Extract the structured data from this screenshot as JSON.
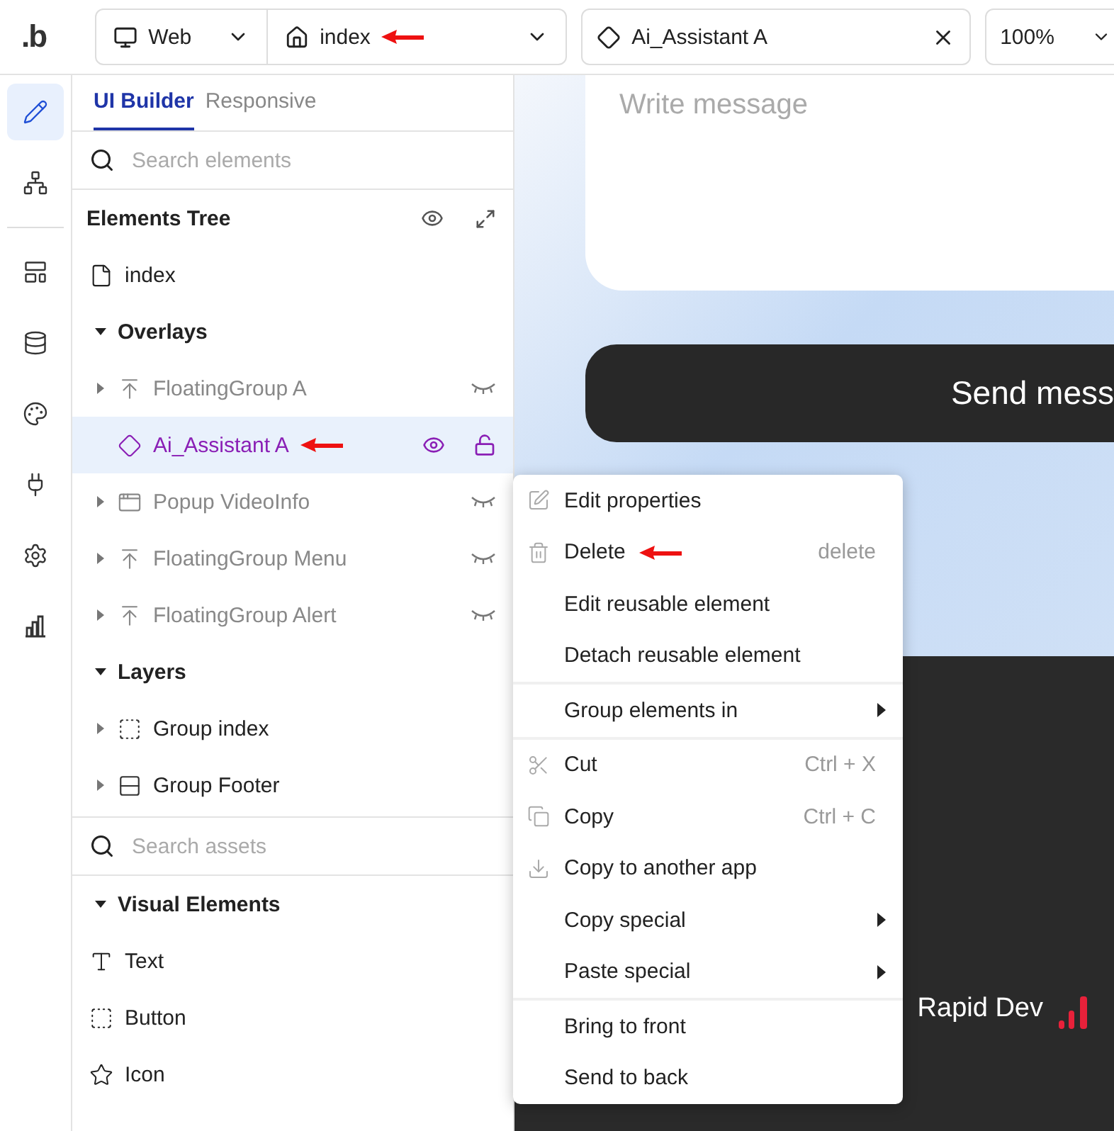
{
  "toolbar": {
    "logo": ".b",
    "platform": "Web",
    "page": {
      "label": "index",
      "annotated": true
    },
    "element": "Ai_Assistant A",
    "zoom": "100%"
  },
  "rail": [
    {
      "selected": true
    },
    {
      "selected": false
    },
    {
      "selected": false
    },
    {
      "selected": false
    },
    {
      "selected": false
    },
    {
      "selected": false
    },
    {
      "selected": false
    },
    {
      "selected": false
    }
  ],
  "panel_tabs": [
    {
      "label": "UI Builder",
      "selected": true
    },
    {
      "label": "Responsive",
      "selected": false
    }
  ],
  "search_elements": {
    "placeholder": "Search elements"
  },
  "tree_title": "Elements Tree",
  "page_item": "index",
  "sections": [
    {
      "label": "Overlays",
      "expanded": true,
      "items": [
        {
          "kind": "floating",
          "label": "FloatingGroup A",
          "has_children": true,
          "hidden": true,
          "selected": false,
          "annotated": false
        },
        {
          "kind": "reusable",
          "label": "Ai_Assistant A",
          "has_children": false,
          "hidden": false,
          "selected": true,
          "annotated": true
        },
        {
          "kind": "popup",
          "label": "Popup VideoInfo",
          "has_children": true,
          "hidden": true,
          "selected": false,
          "annotated": false
        },
        {
          "kind": "floating",
          "label": "FloatingGroup Menu",
          "has_children": true,
          "hidden": true,
          "selected": false,
          "annotated": false
        },
        {
          "kind": "floating",
          "label": "FloatingGroup Alert",
          "has_children": true,
          "hidden": true,
          "selected": false,
          "annotated": false
        }
      ]
    },
    {
      "label": "Layers",
      "expanded": true,
      "items": [
        {
          "kind": "group",
          "label": "Group index",
          "has_children": true,
          "hidden": false,
          "selected": false,
          "annotated": false
        },
        {
          "kind": "rows",
          "label": "Group Footer",
          "has_children": true,
          "hidden": false,
          "selected": false,
          "annotated": false
        }
      ]
    }
  ],
  "search_assets": {
    "placeholder": "Search assets"
  },
  "assets": {
    "label": "Visual Elements",
    "expanded": true,
    "items": [
      {
        "kind": "text",
        "label": "Text"
      },
      {
        "kind": "button",
        "label": "Button"
      },
      {
        "kind": "icon",
        "label": "Icon"
      }
    ]
  },
  "canvas": {
    "message_placeholder": "Write message",
    "send_button": "Send mess",
    "footer_brand": "Rapid Dev"
  },
  "context_menu": [
    [
      {
        "kind": "edit",
        "label": "Edit properties",
        "annotated": false
      },
      {
        "kind": "delete",
        "label": "Delete",
        "shortcut": "delete",
        "annotated": true
      },
      {
        "kind": "plain",
        "label": "Edit reusable element",
        "annotated": false
      },
      {
        "kind": "plain",
        "label": "Detach reusable element",
        "annotated": false
      }
    ],
    [
      {
        "kind": "plain",
        "label": "Group elements in",
        "submenu": true,
        "annotated": false
      }
    ],
    [
      {
        "kind": "cut",
        "label": "Cut",
        "shortcut": "Ctrl + X",
        "annotated": false
      },
      {
        "kind": "copy",
        "label": "Copy",
        "shortcut": "Ctrl + C",
        "annotated": false
      },
      {
        "kind": "download",
        "label": "Copy to another app",
        "annotated": false
      },
      {
        "kind": "plain",
        "label": "Copy special",
        "submenu": true,
        "annotated": false
      },
      {
        "kind": "plain",
        "label": "Paste special",
        "submenu": true,
        "annotated": false
      }
    ],
    [
      {
        "kind": "plain",
        "label": "Bring to front",
        "annotated": false
      },
      {
        "kind": "plain",
        "label": "Send to back",
        "annotated": false
      }
    ]
  ]
}
